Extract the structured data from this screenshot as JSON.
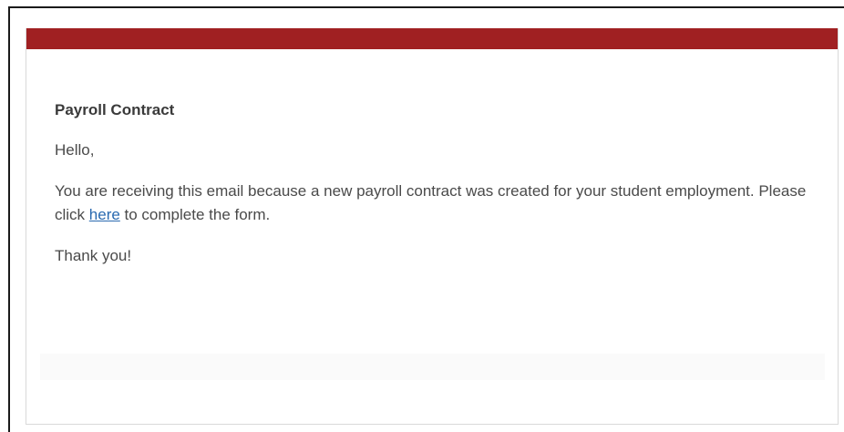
{
  "email": {
    "title": "Payroll Contract",
    "greeting": "Hello,",
    "body_before_link": "You are receiving this email because a new payroll contract was created for your student employment. Please click ",
    "link_text": "here",
    "body_after_link": " to complete the form.",
    "closing": "Thank you!"
  },
  "colors": {
    "header_bar": "#a02022",
    "link": "#2a6ab0"
  }
}
